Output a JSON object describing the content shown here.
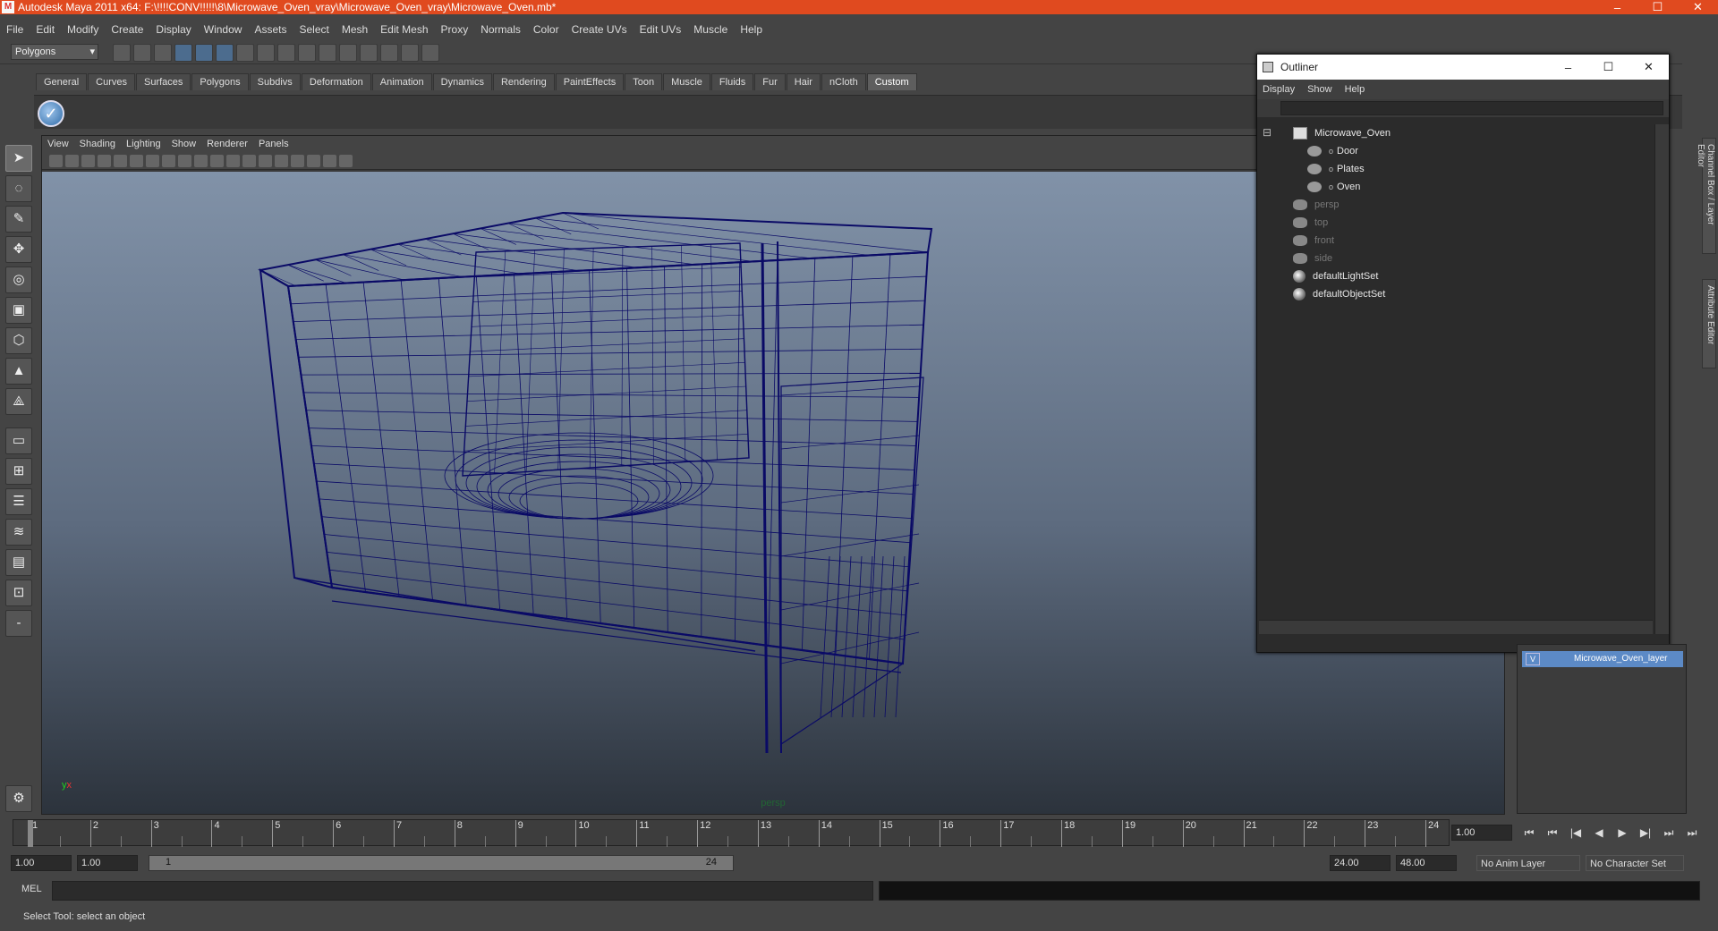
{
  "titlebar": {
    "title": "Autodesk Maya 2011 x64: F:\\!!!!CONV!!!!!\\8\\Microwave_Oven_vray\\Microwave_Oven_vray\\Microwave_Oven.mb*",
    "app_icon": "M",
    "minimize": "–",
    "maximize": "☐",
    "close": "✕"
  },
  "menubar": [
    "File",
    "Edit",
    "Modify",
    "Create",
    "Display",
    "Window",
    "Assets",
    "Select",
    "Mesh",
    "Edit Mesh",
    "Proxy",
    "Normals",
    "Color",
    "Create UVs",
    "Edit UVs",
    "Muscle",
    "Help"
  ],
  "statusline": {
    "mode": "Polygons"
  },
  "shelf": {
    "tabs": [
      "General",
      "Curves",
      "Surfaces",
      "Polygons",
      "Subdivs",
      "Deformation",
      "Animation",
      "Dynamics",
      "Rendering",
      "PaintEffects",
      "Toon",
      "Muscle",
      "Fluids",
      "Fur",
      "Hair",
      "nCloth",
      "Custom"
    ],
    "active": "Custom",
    "check_glyph": "✓"
  },
  "viewport": {
    "menus": [
      "View",
      "Shading",
      "Lighting",
      "Show",
      "Renderer",
      "Panels"
    ],
    "camera_label": "persp",
    "axis_y": "y",
    "axis_x": "x",
    "wire_color": "#0a0a66",
    "gradient_top": "#8192a8",
    "gradient_bottom": "#2c333c"
  },
  "outliner": {
    "title": "Outliner",
    "minimize": "–",
    "maximize": "☐",
    "close": "✕",
    "menus": [
      "Display",
      "Show",
      "Help"
    ],
    "collapse": "⊟",
    "items": [
      {
        "label": "Microwave_Oven",
        "kind": "group",
        "dim": false
      },
      {
        "label": "Door",
        "kind": "mesh",
        "dim": false
      },
      {
        "label": "Plates",
        "kind": "mesh",
        "dim": false
      },
      {
        "label": "Oven",
        "kind": "mesh",
        "dim": false
      },
      {
        "label": "persp",
        "kind": "camera",
        "dim": true
      },
      {
        "label": "top",
        "kind": "camera",
        "dim": true
      },
      {
        "label": "front",
        "kind": "camera",
        "dim": true
      },
      {
        "label": "side",
        "kind": "camera",
        "dim": true
      },
      {
        "label": "defaultLightSet",
        "kind": "set",
        "dim": false
      },
      {
        "label": "defaultObjectSet",
        "kind": "set",
        "dim": false
      }
    ],
    "bullet": "o"
  },
  "right_tabs": {
    "channel": "Channel Box / Layer Editor",
    "attribute": "Attribute Editor"
  },
  "layer": {
    "visible": "V",
    "name": "Microwave_Oven_layer"
  },
  "timeline": {
    "ticks": [
      "1",
      "2",
      "3",
      "4",
      "5",
      "6",
      "7",
      "8",
      "9",
      "10",
      "11",
      "12",
      "13",
      "14",
      "15",
      "16",
      "17",
      "18",
      "19",
      "20",
      "21",
      "22",
      "23",
      "24"
    ],
    "current": "1",
    "current_frame": "1.00"
  },
  "playback": {
    "to_start": "⏮",
    "step_back_key": "⏭",
    "step_back": "|◀",
    "play_back": "◀",
    "play_fwd": "▶",
    "step_fwd": "▶|",
    "step_fwd_key": "⏭",
    "to_end": "⏭"
  },
  "range": {
    "start_time": "1.00",
    "playback_start": "1.00",
    "bar_start": "1",
    "bar_end": "24",
    "playback_end": "24.00",
    "end_time": "48.00",
    "anim_layer": "No Anim Layer",
    "char_set": "No Character Set"
  },
  "command_line": {
    "label": "MEL"
  },
  "help_line": {
    "text": "Select Tool: select an object"
  }
}
